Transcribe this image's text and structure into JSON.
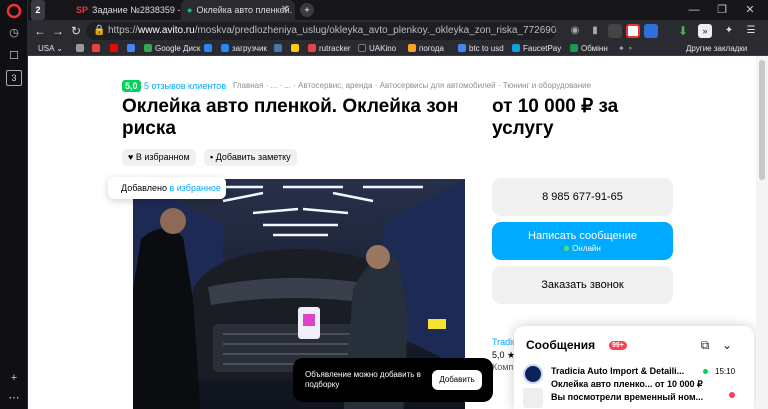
{
  "browser": {
    "rail": {
      "badge": "3"
    },
    "tabs": [
      {
        "label": "2",
        "kind": "counter"
      },
      {
        "label": "Задание №2838359 - про",
        "kind": "inactive"
      },
      {
        "label": "Оклейка авто пленкой. О",
        "kind": "active"
      }
    ],
    "new_tab": "+",
    "window_controls": [
      "—",
      "❐",
      "✕"
    ],
    "url_host": "www.avito.ru",
    "url_path": "/moskva/predlozheniya_uslug/okleyka_avto_plenkoy._okleyka_zon_riska_772690...",
    "url_scheme": "https://",
    "bookmarks": [
      {
        "label": "USA",
        "color": "#3b5bdb"
      },
      {
        "label": "",
        "color": "#999999"
      },
      {
        "label": "",
        "color": "#e8453c"
      },
      {
        "label": "",
        "color": "#ff0000"
      },
      {
        "label": "",
        "color": "#4285f4"
      },
      {
        "label": "Google Диск",
        "color": "#34a853"
      },
      {
        "label": "",
        "color": "#2787f5"
      },
      {
        "label": "загрузчик",
        "color": "#2787f5"
      },
      {
        "label": "",
        "color": "#4a76a8"
      },
      {
        "label": "",
        "color": "#ffcc00"
      },
      {
        "label": "rutracker",
        "color": "#e64646"
      },
      {
        "label": "UAKino",
        "color": "#222222"
      },
      {
        "label": "погода",
        "color": "#f6a623"
      },
      {
        "label": "btc to usd",
        "color": "#4285f4"
      },
      {
        "label": "FaucetPay",
        "color": "#0fa0e0"
      },
      {
        "label": "Обмінн",
        "color": "#1c9a52"
      }
    ],
    "other_bookmarks": "Другие закладки"
  },
  "listing": {
    "rating": "5,0",
    "reviews": "5 отзывов клиентов",
    "breadcrumbs": "Главная  ·  ...  ·  ...  ·  Автосервис, аренда  ·  Автосервисы для автомобилей  ·  Тюнинг и оборудование",
    "title": "Оклейка авто пленкой. Оклейка зон риска",
    "price": "от 10 000 ₽ за услугу",
    "favorite_chip": "В избранном",
    "note_chip": "Добавить заметку",
    "toast_prefix": "Добавлено ",
    "toast_link": "в избранное"
  },
  "actions": {
    "phone": "8 985 677-91-65",
    "write_message": "Написать сообщение",
    "online": "Онлайн",
    "request_call": "Заказать звонок"
  },
  "seller": {
    "name_partial": "Tradicia",
    "rating_partial": "5,0 ★",
    "company_partial": "Комп"
  },
  "banner": {
    "text": "Объявление можно добавить в подборку",
    "button": "Добавить"
  },
  "messages": {
    "title": "Сообщения",
    "count": "99+",
    "seller": "Tradicia Auto Import & Detaili...",
    "time": "15:10",
    "subject": "Оклейка авто пленко... от 10 000 ₽",
    "preview": "Вы посмотрели временный ном..."
  }
}
